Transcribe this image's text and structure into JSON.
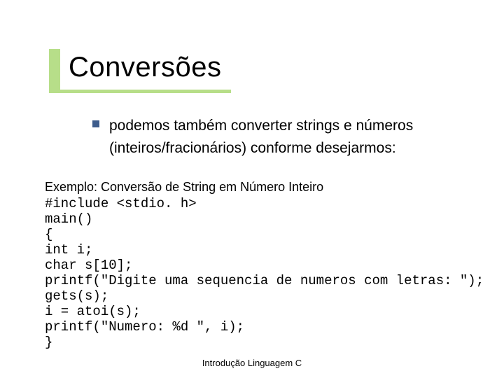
{
  "title": "Conversões",
  "bullet": {
    "line1": "podemos também converter strings e números",
    "line2": "(inteiros/fracionários) conforme desejarmos:"
  },
  "example": {
    "heading": "Exemplo: Conversão de String em Número Inteiro",
    "code": [
      "#include <stdio. h>",
      "main()",
      "{",
      "int i;",
      "char s[10];",
      "printf(\"Digite uma sequencia de numeros com letras: \");",
      "gets(s);",
      "i = atoi(s);",
      "printf(\"Numero: %d \", i);",
      "}"
    ]
  },
  "footer": "Introdução Linguagem C"
}
